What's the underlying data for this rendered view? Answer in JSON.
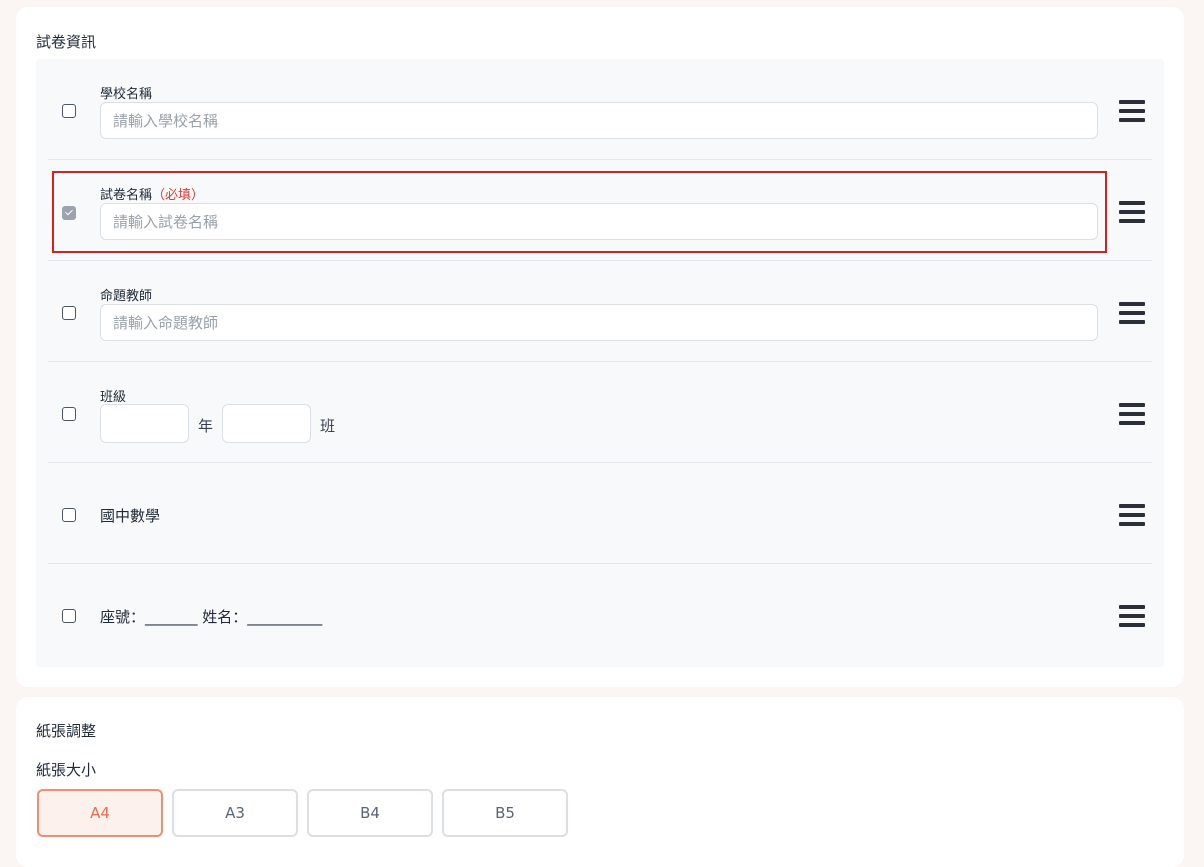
{
  "exam_info": {
    "title": "試卷資訊",
    "rows": [
      {
        "label": "學校名稱",
        "required": "",
        "placeholder": "請輸入學校名稱",
        "checked": false
      },
      {
        "label": "試卷名稱",
        "required": "（必填）",
        "placeholder": "請輸入試卷名稱",
        "checked": true
      },
      {
        "label": "命題教師",
        "required": "",
        "placeholder": "請輸入命題教師",
        "checked": false
      }
    ],
    "class_row": {
      "label": "班級",
      "year_unit": "年",
      "class_unit": "班"
    },
    "subject_row": {
      "text": "國中數學"
    },
    "seat_row": {
      "text": "座號：_______ 姓名：__________"
    }
  },
  "paper": {
    "title": "紙張調整",
    "size_label": "紙張大小",
    "sizes": [
      "A4",
      "A3",
      "B4",
      "B5"
    ],
    "selected": "A4"
  },
  "colors": {
    "required": "#e53935",
    "highlight": "#d81e1e",
    "accent": "#ee6a4d"
  },
  "icons": {
    "drag_handle": "hamburger-icon"
  }
}
